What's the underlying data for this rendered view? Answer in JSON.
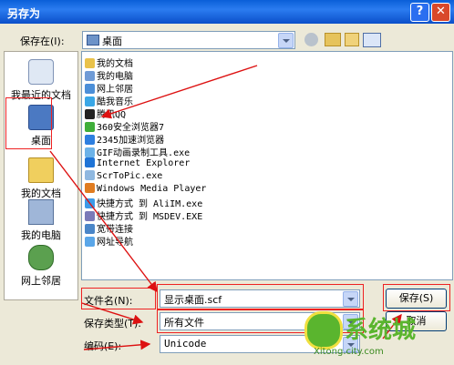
{
  "window": {
    "title": "另存为",
    "help": "?",
    "close": "✕"
  },
  "save_in": {
    "label": "保存在(I):",
    "value": "桌面"
  },
  "places": [
    {
      "label": "我最近的文档"
    },
    {
      "label": "桌面"
    },
    {
      "label": "我的文档"
    },
    {
      "label": "我的电脑"
    },
    {
      "label": "网上邻居"
    }
  ],
  "files": [
    {
      "name": "我的文档",
      "color": "#e9c24a"
    },
    {
      "name": "我的电脑",
      "color": "#6f9bd6"
    },
    {
      "name": "网上邻居",
      "color": "#4c8fd8"
    },
    {
      "name": "酷我音乐",
      "color": "#3aa7e6"
    },
    {
      "name": "腾讯QQ",
      "color": "#222222"
    },
    {
      "name": "360安全浏览器7",
      "color": "#3fae3a"
    },
    {
      "name": "2345加速浏览器",
      "color": "#2d7fe0"
    },
    {
      "name": "GIF动画录制工具.exe",
      "color": "#6bb2e8"
    },
    {
      "name": "Internet Explorer",
      "color": "#1f74d6"
    },
    {
      "name": "ScrToPic.exe",
      "color": "#8fb8e0"
    },
    {
      "name": "Windows Media Player",
      "color": "#e07c21"
    },
    {
      "name": "快捷方式 到 AliIM.exe",
      "color": "#3c9ae8"
    },
    {
      "name": "快捷方式 到 MSDEV.EXE",
      "color": "#7a7ab8"
    },
    {
      "name": "宽带连接",
      "color": "#4a86c8"
    },
    {
      "name": "网址导航",
      "color": "#5aa6e8"
    }
  ],
  "filename": {
    "label": "文件名(N):",
    "value": "显示桌面.scf"
  },
  "filetype": {
    "label": "保存类型(T):",
    "value": "所有文件"
  },
  "encoding": {
    "label": "编码(E):",
    "value": "Unicode"
  },
  "buttons": {
    "save": "保存(S)",
    "cancel": "取消"
  },
  "watermark": {
    "text": "系统城",
    "url": "Xitong.city.com"
  }
}
